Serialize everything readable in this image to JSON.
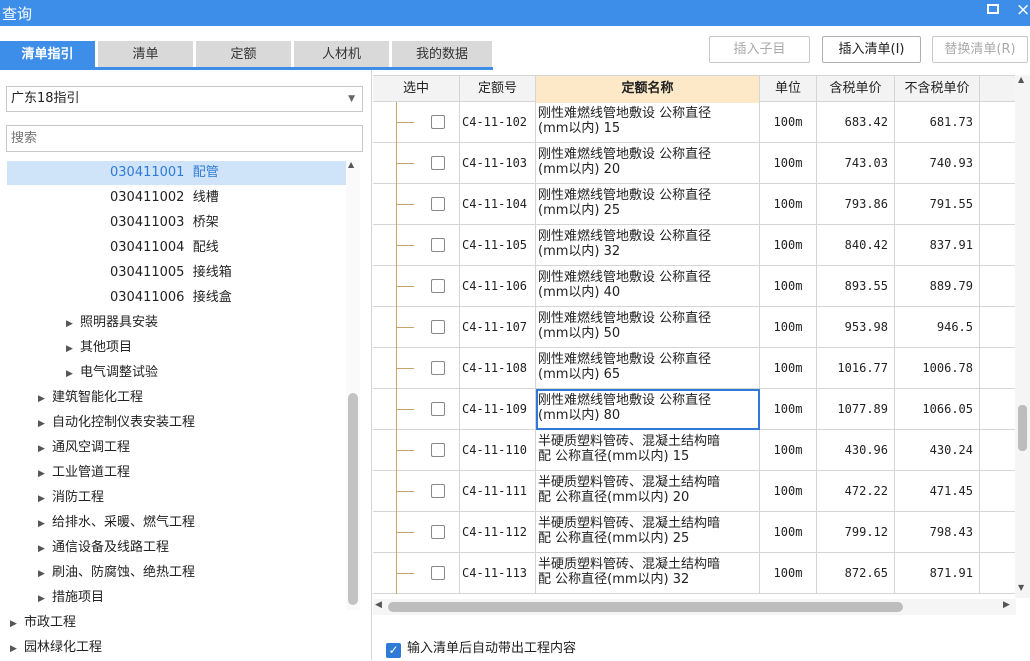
{
  "window": {
    "title": "查询",
    "restore_icon": "restore-icon",
    "close_glyph": "×"
  },
  "tabs": [
    "清单指引",
    "清单",
    "定额",
    "人材机",
    "我的数据"
  ],
  "toolbar": {
    "insert_child": "插入子目",
    "insert_list": "插入清单(I)",
    "replace_list": "替换清单(R)"
  },
  "left": {
    "guide": "广东18指引",
    "search_placeholder": "搜索",
    "tree": [
      {
        "code": "030411001",
        "label": "配管"
      },
      {
        "code": "030411002",
        "label": "线槽"
      },
      {
        "code": "030411003",
        "label": "桥架"
      },
      {
        "code": "030411004",
        "label": "配线"
      },
      {
        "code": "030411005",
        "label": "接线箱"
      },
      {
        "code": "030411006",
        "label": "接线盒"
      },
      {
        "label": "照明器具安装"
      },
      {
        "label": "其他项目"
      },
      {
        "label": "电气调整试验"
      },
      {
        "label": "建筑智能化工程"
      },
      {
        "label": "自动化控制仪表安装工程"
      },
      {
        "label": "通风空调工程"
      },
      {
        "label": "工业管道工程"
      },
      {
        "label": "消防工程"
      },
      {
        "label": "给排水、采暖、燃气工程"
      },
      {
        "label": "通信设备及线路工程"
      },
      {
        "label": "刷油、防腐蚀、绝热工程"
      },
      {
        "label": "措施项目"
      },
      {
        "label": "市政工程"
      },
      {
        "label": "园林绿化工程"
      }
    ]
  },
  "grid": {
    "headers": [
      "选中",
      "定额号",
      "定额名称",
      "单位",
      "含税单价",
      "不含税单价"
    ],
    "rows": [
      {
        "code": "C4-11-102",
        "name1": "刚性难燃线管地敷设 公称直径",
        "name2": "(mm以内) 15",
        "unit": "100m",
        "price_tax": "683.42",
        "price_notax": "681.73"
      },
      {
        "code": "C4-11-103",
        "name1": "刚性难燃线管地敷设 公称直径",
        "name2": "(mm以内) 20",
        "unit": "100m",
        "price_tax": "743.03",
        "price_notax": "740.93"
      },
      {
        "code": "C4-11-104",
        "name1": "刚性难燃线管地敷设 公称直径",
        "name2": "(mm以内) 25",
        "unit": "100m",
        "price_tax": "793.86",
        "price_notax": "791.55"
      },
      {
        "code": "C4-11-105",
        "name1": "刚性难燃线管地敷设 公称直径",
        "name2": "(mm以内) 32",
        "unit": "100m",
        "price_tax": "840.42",
        "price_notax": "837.91"
      },
      {
        "code": "C4-11-106",
        "name1": "刚性难燃线管地敷设 公称直径",
        "name2": "(mm以内) 40",
        "unit": "100m",
        "price_tax": "893.55",
        "price_notax": "889.79"
      },
      {
        "code": "C4-11-107",
        "name1": "刚性难燃线管地敷设 公称直径",
        "name2": "(mm以内) 50",
        "unit": "100m",
        "price_tax": "953.98",
        "price_notax": "946.5"
      },
      {
        "code": "C4-11-108",
        "name1": "刚性难燃线管地敷设 公称直径",
        "name2": "(mm以内) 65",
        "unit": "100m",
        "price_tax": "1016.77",
        "price_notax": "1006.78"
      },
      {
        "code": "C4-11-109",
        "name1": "刚性难燃线管地敷设 公称直径",
        "name2": "(mm以内) 80",
        "unit": "100m",
        "price_tax": "1077.89",
        "price_notax": "1066.05"
      },
      {
        "code": "C4-11-110",
        "name1": "半硬质塑料管砖、混凝土结构暗",
        "name2": "配 公称直径(mm以内) 15",
        "unit": "100m",
        "price_tax": "430.96",
        "price_notax": "430.24"
      },
      {
        "code": "C4-11-111",
        "name1": "半硬质塑料管砖、混凝土结构暗",
        "name2": "配 公称直径(mm以内) 20",
        "unit": "100m",
        "price_tax": "472.22",
        "price_notax": "471.45"
      },
      {
        "code": "C4-11-112",
        "name1": "半硬质塑料管砖、混凝土结构暗",
        "name2": "配 公称直径(mm以内) 25",
        "unit": "100m",
        "price_tax": "799.12",
        "price_notax": "798.43"
      },
      {
        "code": "C4-11-113",
        "name1": "半硬质塑料管砖、混凝土结构暗",
        "name2": "配 公称直径(mm以内) 32",
        "unit": "100m",
        "price_tax": "872.65",
        "price_notax": "871.91"
      }
    ]
  },
  "bottom": {
    "auto_bring_label": "输入清单后自动带出工程内容",
    "auto_bring_checked": true
  },
  "colors": {
    "accent": "#3d8ee8",
    "selected_text": "#2f7ad6",
    "header_highlight": "#fde9c8"
  }
}
